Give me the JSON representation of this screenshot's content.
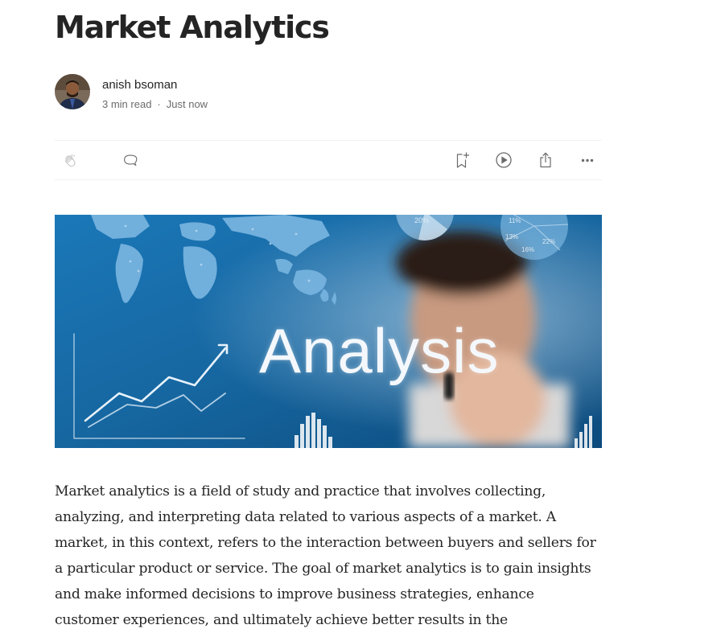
{
  "article": {
    "title": "Market Analytics",
    "author": {
      "name": "anish bsoman",
      "read_time": "3 min read",
      "separator": "·",
      "published": "Just now"
    },
    "actions": [
      {
        "name": "clap",
        "icon": "clap-icon"
      },
      {
        "name": "respond",
        "icon": "comment-icon"
      },
      {
        "name": "save",
        "icon": "bookmark-add-icon"
      },
      {
        "name": "listen",
        "icon": "play-icon"
      },
      {
        "name": "share",
        "icon": "share-icon"
      },
      {
        "name": "more",
        "icon": "more-icon"
      }
    ],
    "hero_image": {
      "word": "Analysis",
      "pie_labels": [
        "20%",
        "11%",
        "13%",
        "22%",
        "16%"
      ]
    },
    "body": "Market analytics is a field of study and practice that involves collecting, analyzing, and interpreting data related to various aspects of a market. A market, in this context, refers to the interaction between buyers and sellers for a particular product or service. The goal of market analytics is to gain insights and make informed decisions to improve business strategies, enhance customer experiences, and ultimately achieve better results in the"
  },
  "colors": {
    "text": "#242424",
    "muted": "#6b6b6b",
    "divider": "#f2f2f2",
    "hero_blue": "#1a6aa5"
  }
}
